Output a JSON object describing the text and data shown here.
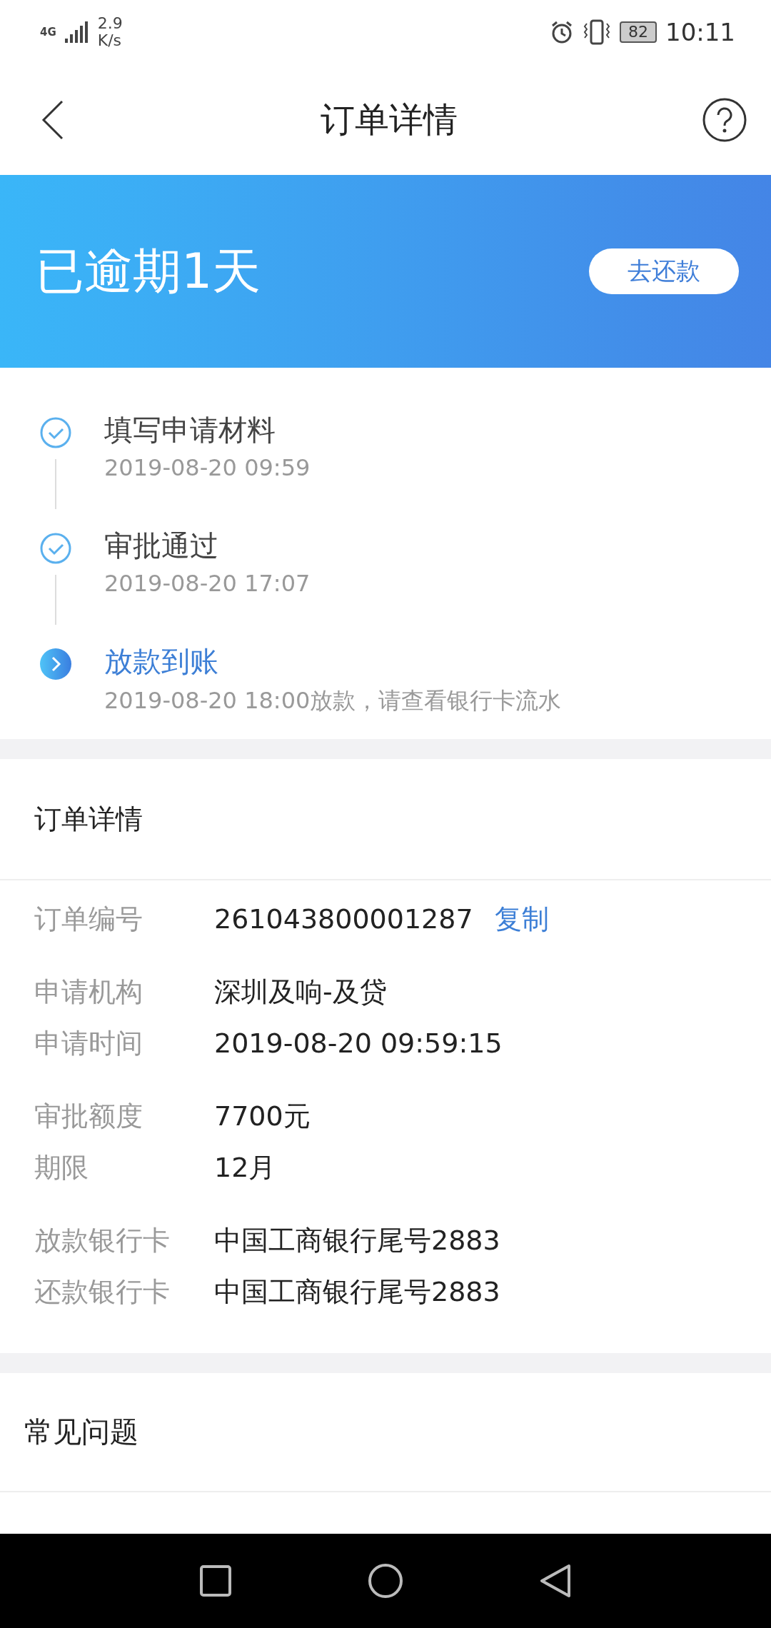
{
  "status_bar": {
    "network": "4G",
    "speed_value": "2.9",
    "speed_unit": "K/s",
    "battery": "82",
    "time": "10:11"
  },
  "header": {
    "title": "订单详情"
  },
  "banner": {
    "status": "已逾期1天",
    "button": "去还款"
  },
  "timeline": [
    {
      "kind": "done",
      "title": "填写申请材料",
      "time": "2019-08-20 09:59"
    },
    {
      "kind": "done",
      "title": "审批通过",
      "time": "2019-08-20 17:07"
    },
    {
      "kind": "current",
      "title": "放款到账",
      "time": "2019-08-20 18:00放款，请查看银行卡流水"
    }
  ],
  "details": {
    "title": "订单详情",
    "groups": [
      [
        {
          "label": "订单编号",
          "value": "261043800001287",
          "link": "复制"
        }
      ],
      [
        {
          "label": "申请机构",
          "value": "深圳及响-及贷"
        },
        {
          "label": "申请时间",
          "value": "2019-08-20 09:59:15"
        }
      ],
      [
        {
          "label": "审批额度",
          "value": "7700元"
        },
        {
          "label": "期限",
          "value": "12月"
        }
      ],
      [
        {
          "label": "放款银行卡",
          "value": "中国工商银行尾号2883"
        },
        {
          "label": "还款银行卡",
          "value": "中国工商银行尾号2883"
        }
      ]
    ]
  },
  "faq": {
    "title": "常见问题"
  }
}
